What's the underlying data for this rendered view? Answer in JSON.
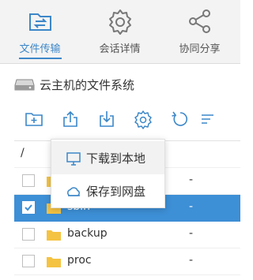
{
  "tabs": [
    {
      "label": "文件传输",
      "icon": "file-transfer-icon",
      "active": true
    },
    {
      "label": "会话详情",
      "icon": "gear-icon",
      "active": false
    },
    {
      "label": "协同分享",
      "icon": "share-icon",
      "active": false
    }
  ],
  "section": {
    "title": "云主机的文件系统",
    "icon": "hard-drive-icon"
  },
  "toolbar": {
    "buttons": [
      "new-folder-icon",
      "upload-icon",
      "download-icon",
      "settings-icon",
      "refresh-icon",
      "sort-icon"
    ]
  },
  "file_table": {
    "path": "/",
    "rows": [
      {
        "name": "",
        "size": "-",
        "checked": false,
        "selected": false
      },
      {
        "name": "sbin",
        "size": "-",
        "checked": true,
        "selected": true
      },
      {
        "name": "backup",
        "size": "-",
        "checked": false,
        "selected": false
      },
      {
        "name": "proc",
        "size": "-",
        "checked": false,
        "selected": false
      }
    ]
  },
  "download_menu": {
    "items": [
      {
        "label": "下载到本地",
        "icon": "monitor-icon"
      },
      {
        "label": "保存到网盘",
        "icon": "cloud-drive-icon"
      }
    ]
  },
  "colors": {
    "accent": "#3c87c8",
    "selected_row": "#3d8fd6",
    "folder": "#f5c342"
  }
}
